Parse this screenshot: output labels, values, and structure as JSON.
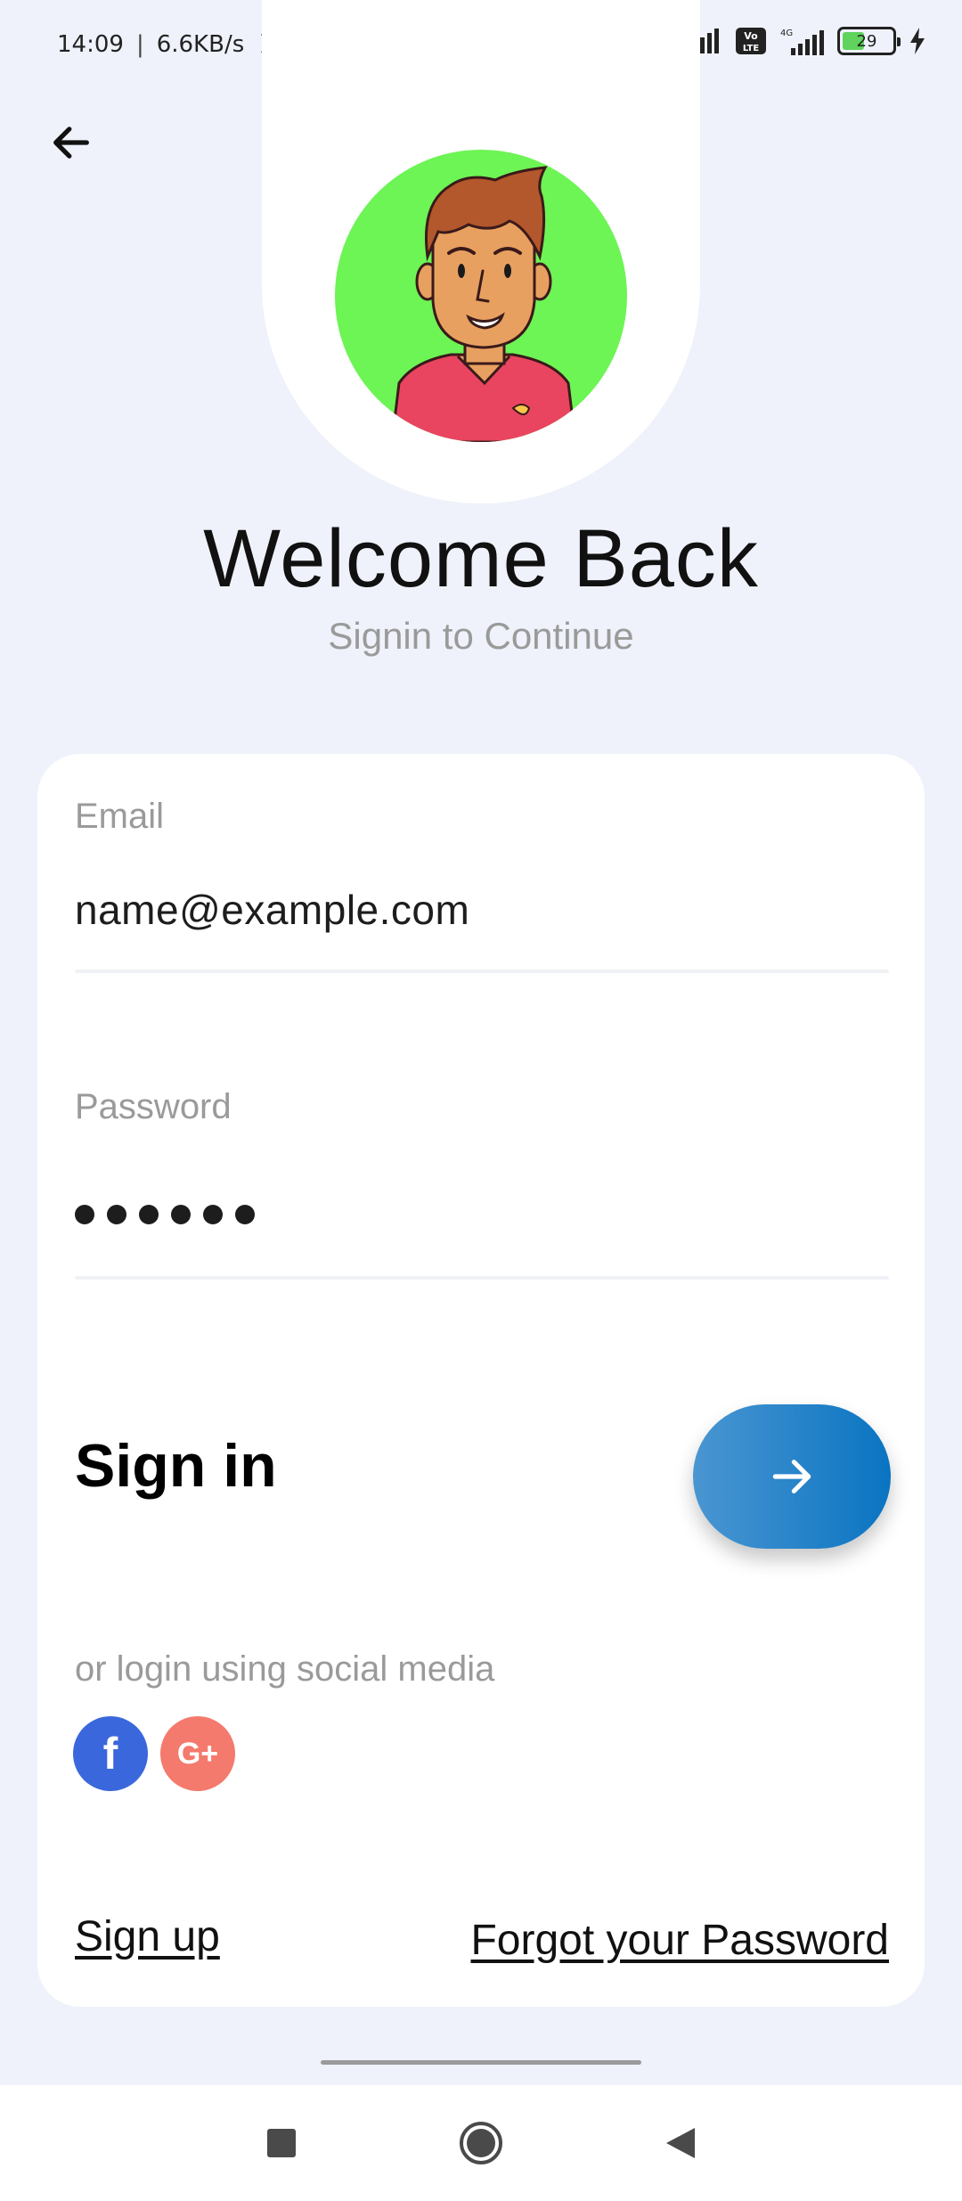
{
  "status_bar": {
    "time": "14:09",
    "separator": "|",
    "net_speed": "6.6KB/s",
    "battery_level": "29",
    "net_type": "4G",
    "volte": "Vo LTE",
    "icons": [
      "mute-icon",
      "alarm-icon",
      "share-icon",
      "vpn-icon",
      "signal-icon",
      "volte-icon",
      "signal-4g-icon",
      "battery-icon",
      "charging-icon"
    ]
  },
  "header": {
    "back_icon": "arrow-left-icon",
    "avatar_icon": "avatar-illustration",
    "title": "Welcome Back",
    "subtitle": "Signin to Continue"
  },
  "form": {
    "email_label": "Email",
    "email_value": "name@example.com",
    "password_label": "Password",
    "password_mask_length": 6,
    "submit_label": "Sign in",
    "submit_icon": "arrow-right-icon"
  },
  "social": {
    "label": "or login using social media",
    "facebook": "f",
    "google": "G+"
  },
  "links": {
    "signup": "Sign up",
    "forgot": "Forgot your Password"
  },
  "colors": {
    "background": "#eff2fa",
    "avatar_bg": "#6df455",
    "accent_start": "#4a96d1",
    "accent_end": "#0a74c2",
    "facebook": "#3b67dc",
    "google": "#f47a6d"
  },
  "nav": [
    "recents-icon",
    "home-icon",
    "back-icon"
  ]
}
